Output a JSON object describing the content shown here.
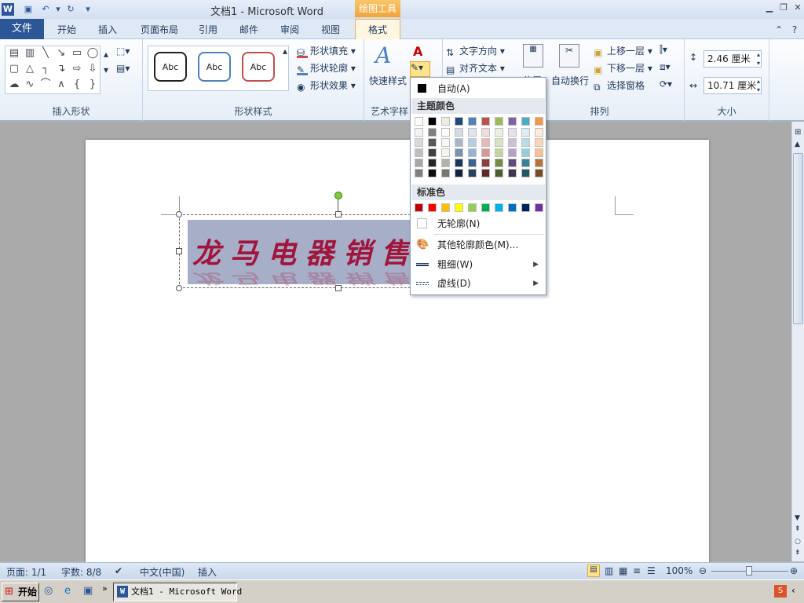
{
  "window": {
    "title": "文档1 - Microsoft Word",
    "contextual_tab_header": "绘图工具"
  },
  "tabs": [
    {
      "label": "文件"
    },
    {
      "label": "开始"
    },
    {
      "label": "插入"
    },
    {
      "label": "页面布局"
    },
    {
      "label": "引用"
    },
    {
      "label": "邮件"
    },
    {
      "label": "审阅"
    },
    {
      "label": "视图"
    },
    {
      "label": "格式"
    }
  ],
  "ribbon": {
    "insert_shapes_label": "插入形状",
    "shape_styles_label": "形状样式",
    "style_sample": "Abc",
    "shape_fill": "形状填充",
    "shape_outline": "形状轮廓",
    "shape_effects": "形状效果",
    "wordart_label": "艺术字样",
    "quick_styles": "快速样式",
    "text_direction": "文字方向",
    "align_text": "对齐文本",
    "position": "位置",
    "wrap_text": "自动换行",
    "bring_forward": "上移一层",
    "send_backward": "下移一层",
    "selection_pane": "选择窗格",
    "arrange_label": "排列",
    "size_label": "大小",
    "height": "2.46 厘米",
    "width": "10.71 厘米"
  },
  "wordart": {
    "text": "龙马电器销售"
  },
  "dropdown": {
    "auto": "自动(A)",
    "theme_colors_header": "主题颜色",
    "standard_colors_header": "标准色",
    "no_outline": "无轮廓(N)",
    "more_colors": "其他轮廓颜色(M)...",
    "weight": "粗细(W)",
    "dashes": "虚线(D)",
    "theme_top": [
      "#ffffff",
      "#000000",
      "#eeece1",
      "#1f497d",
      "#4f81bd",
      "#c0504d",
      "#9bbb59",
      "#8064a2",
      "#4bacc6",
      "#f79646"
    ],
    "standard": [
      "#c00000",
      "#ff0000",
      "#ffc000",
      "#ffff00",
      "#92d050",
      "#00b050",
      "#00b0f0",
      "#0070c0",
      "#002060",
      "#7030a0"
    ]
  },
  "statusbar": {
    "page": "页面: 1/1",
    "words": "字数: 8/8",
    "language": "中文(中国)",
    "insert_mode": "插入",
    "zoom": "100%"
  },
  "taskbar": {
    "start": "开始",
    "word_task": "文档1 - Microsoft Word"
  }
}
